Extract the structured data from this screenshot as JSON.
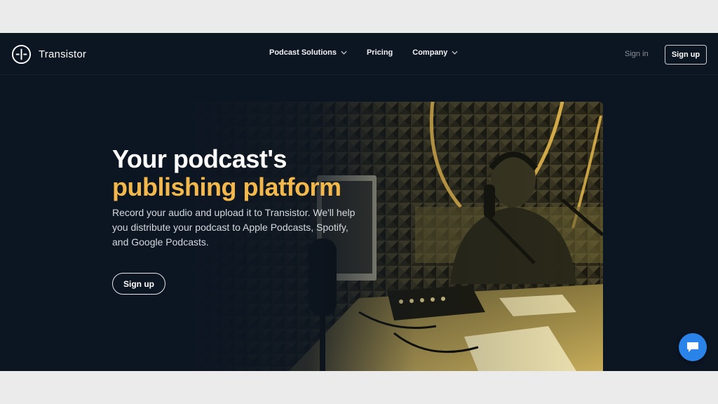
{
  "brand": {
    "name": "Transistor",
    "icon": "transistor-logo-icon"
  },
  "nav": {
    "items": [
      {
        "label": "Podcast Solutions",
        "has_dropdown": true
      },
      {
        "label": "Pricing",
        "has_dropdown": false
      },
      {
        "label": "Company",
        "has_dropdown": true
      }
    ],
    "signin_label": "Sign in",
    "signup_label": "Sign up"
  },
  "hero": {
    "title_line1": "Your podcast's",
    "title_line2": "publishing platform",
    "description": "Record your audio and upload it to Transistor. We'll help you distribute your podcast to Apple Podcasts, Spotify, and Google Podcasts.",
    "cta_label": "Sign up",
    "image": "podcaster-in-studio-photo"
  },
  "chat_widget": {
    "icon": "chat-bubble-icon"
  },
  "colors": {
    "background": "#0c1522",
    "accent": "#f3b84b",
    "page": "#ebebeb",
    "chat": "#2a83e9"
  }
}
